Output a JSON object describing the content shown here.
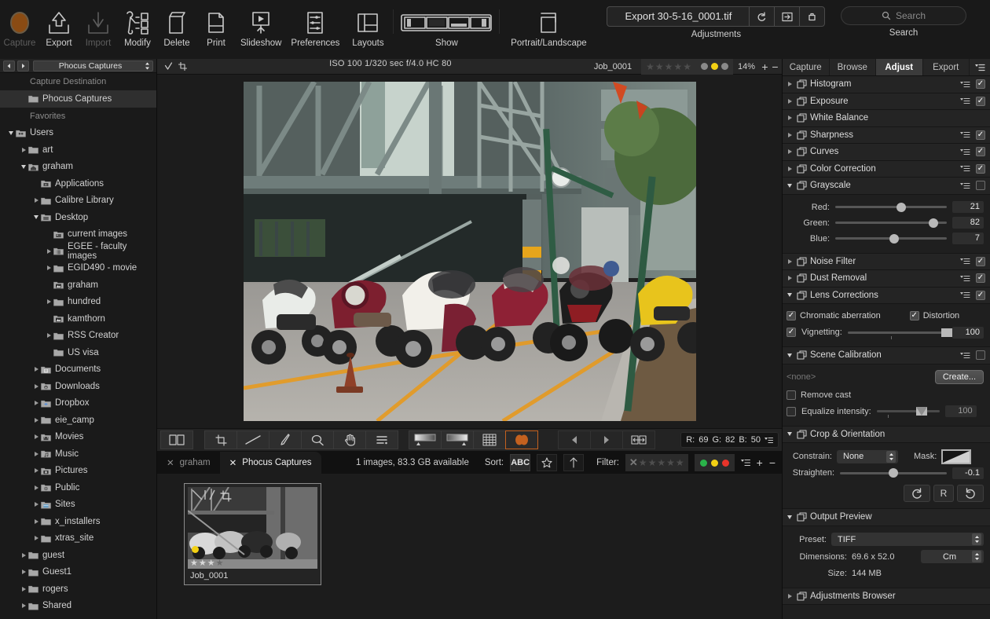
{
  "toolbar": {
    "items": [
      {
        "label": "Capture",
        "icon": "capture-icon",
        "dim": true
      },
      {
        "label": "Export",
        "icon": "export-icon",
        "dim": false
      },
      {
        "label": "Import",
        "icon": "import-icon",
        "dim": true
      },
      {
        "label": "Modify",
        "icon": "modify-icon",
        "dim": false
      },
      {
        "label": "Delete",
        "icon": "delete-icon",
        "dim": false
      },
      {
        "label": "Print",
        "icon": "print-icon",
        "dim": false
      },
      {
        "label": "Slideshow",
        "icon": "slideshow-icon",
        "dim": false
      },
      {
        "label": "Preferences",
        "icon": "preferences-icon",
        "dim": false
      },
      {
        "label": "Layouts",
        "icon": "layouts-icon",
        "dim": false
      },
      {
        "label": "Show",
        "icon": "show-icon",
        "dim": false
      },
      {
        "label": "Portrait/Landscape",
        "icon": "portrait-landscape-icon",
        "dim": false
      }
    ],
    "adjustments": {
      "label": "Adjustments",
      "value": "Export 30-5-16_0001.tif",
      "reset_icon": "reset-arrow-icon",
      "apply_icon": "apply-to-icon",
      "paste_icon": "paste-adjustments-icon"
    },
    "search": {
      "label": "Search",
      "placeholder": "Search",
      "icon": "search-icon"
    }
  },
  "sidebar": {
    "popup_value": "Phocus Captures",
    "sections": [
      {
        "title": "Capture Destination",
        "rows": [
          {
            "label": "Phocus Captures",
            "indent": 1,
            "twisty": "none",
            "icon": "folder-icon",
            "selected": true
          }
        ]
      },
      {
        "title": "Favorites",
        "rows": [
          {
            "label": "Users",
            "indent": 0,
            "twisty": "down",
            "icon": "users-folder-icon",
            "selected": false
          },
          {
            "label": "art",
            "indent": 1,
            "twisty": "right",
            "icon": "folder-icon",
            "selected": false
          },
          {
            "label": "graham",
            "indent": 1,
            "twisty": "down",
            "icon": "home-folder-icon",
            "selected": false
          },
          {
            "label": "Applications",
            "indent": 2,
            "twisty": "none",
            "icon": "applications-folder-icon",
            "selected": false
          },
          {
            "label": "Calibre Library",
            "indent": 2,
            "twisty": "right",
            "icon": "folder-icon",
            "selected": false
          },
          {
            "label": "Desktop",
            "indent": 2,
            "twisty": "down",
            "icon": "desktop-folder-icon",
            "selected": false
          },
          {
            "label": "current images",
            "indent": 3,
            "twisty": "none",
            "icon": "image-folder-icon",
            "selected": false
          },
          {
            "label": "EGEE - faculty images",
            "indent": 3,
            "twisty": "right",
            "icon": "book-folder-icon",
            "selected": false
          },
          {
            "label": "EGID490 - movie",
            "indent": 3,
            "twisty": "right",
            "icon": "folder-icon",
            "selected": false
          },
          {
            "label": "graham",
            "indent": 3,
            "twisty": "none",
            "icon": "photo-folder-icon",
            "selected": false
          },
          {
            "label": "hundred",
            "indent": 3,
            "twisty": "right",
            "icon": "folder-icon",
            "selected": false
          },
          {
            "label": "kamthorn",
            "indent": 3,
            "twisty": "none",
            "icon": "photo-folder-icon",
            "selected": false
          },
          {
            "label": "RSS Creator",
            "indent": 3,
            "twisty": "right",
            "icon": "folder-icon",
            "selected": false
          },
          {
            "label": "US visa",
            "indent": 3,
            "twisty": "none",
            "icon": "folder-icon",
            "selected": false
          },
          {
            "label": "Documents",
            "indent": 2,
            "twisty": "right",
            "icon": "documents-folder-icon",
            "selected": false
          },
          {
            "label": "Downloads",
            "indent": 2,
            "twisty": "right",
            "icon": "downloads-folder-icon",
            "selected": false
          },
          {
            "label": "Dropbox",
            "indent": 2,
            "twisty": "right",
            "icon": "dropbox-folder-icon",
            "selected": false
          },
          {
            "label": "eie_camp",
            "indent": 2,
            "twisty": "right",
            "icon": "folder-icon",
            "selected": false
          },
          {
            "label": "Movies",
            "indent": 2,
            "twisty": "right",
            "icon": "movies-folder-icon",
            "selected": false
          },
          {
            "label": "Music",
            "indent": 2,
            "twisty": "right",
            "icon": "music-folder-icon",
            "selected": false
          },
          {
            "label": "Pictures",
            "indent": 2,
            "twisty": "right",
            "icon": "pictures-folder-icon",
            "selected": false
          },
          {
            "label": "Public",
            "indent": 2,
            "twisty": "right",
            "icon": "public-folder-icon",
            "selected": false
          },
          {
            "label": "Sites",
            "indent": 2,
            "twisty": "right",
            "icon": "sites-folder-icon",
            "selected": false
          },
          {
            "label": "x_installers",
            "indent": 2,
            "twisty": "right",
            "icon": "folder-icon",
            "selected": false
          },
          {
            "label": "xtras_site",
            "indent": 2,
            "twisty": "right",
            "icon": "folder-icon",
            "selected": false
          },
          {
            "label": "guest",
            "indent": 1,
            "twisty": "right",
            "icon": "folder-icon",
            "selected": false
          },
          {
            "label": "Guest1",
            "indent": 1,
            "twisty": "right",
            "icon": "folder-icon",
            "selected": false
          },
          {
            "label": "rogers",
            "indent": 1,
            "twisty": "right",
            "icon": "folder-icon",
            "selected": false
          },
          {
            "label": "Shared",
            "indent": 1,
            "twisty": "right",
            "icon": "folder-icon",
            "selected": false
          }
        ]
      }
    ]
  },
  "infobar": {
    "exif": "ISO 100  1/320 sec  f/4.0  HC 80",
    "job": "Job_0001",
    "stars": 0,
    "zoom": "14%",
    "plus": "+",
    "minus": "−",
    "dot_colors": [
      "#8a8a8a",
      "#f2d014",
      "#8a8a8a"
    ]
  },
  "tools": {
    "buttons": [
      {
        "name": "compare-icon"
      },
      {
        "name": "crop-icon"
      },
      {
        "name": "straighten-icon"
      },
      {
        "name": "eyedropper-icon"
      },
      {
        "name": "zoom-tool-icon"
      },
      {
        "name": "hand-tool-icon"
      },
      {
        "name": "levels-icon"
      },
      {
        "name": "gradient-down-icon"
      },
      {
        "name": "gradient-up-icon"
      },
      {
        "name": "grid-icon"
      },
      {
        "name": "mask-orange-icon"
      },
      {
        "name": "prev-icon"
      },
      {
        "name": "next-icon"
      },
      {
        "name": "flip-icon"
      }
    ],
    "rgb": {
      "r_label": "R:",
      "r": "69",
      "g_label": "G:",
      "g": "82",
      "b_label": "B:",
      "b": "50"
    }
  },
  "browser": {
    "tabs": [
      {
        "label": "graham",
        "active": false
      },
      {
        "label": "Phocus Captures",
        "active": true
      }
    ],
    "status": "1 images, 83.3 GB available",
    "sort_label": "Sort:",
    "sort_value": "ABC",
    "filter_label": "Filter:",
    "filter_colors": [
      "#2ab34a",
      "#f2d014",
      "#e8342a"
    ],
    "thumbnail": {
      "name": "Job_0001",
      "stars": 3,
      "dot_color": "#f2d014"
    }
  },
  "right": {
    "tabs": [
      {
        "label": "Capture",
        "active": false
      },
      {
        "label": "Browse",
        "active": false
      },
      {
        "label": "Adjust",
        "active": true
      },
      {
        "label": "Export",
        "active": false
      }
    ],
    "tools": [
      {
        "name": "Histogram",
        "open": false,
        "checked": true,
        "menu": true
      },
      {
        "name": "Exposure",
        "open": false,
        "checked": true,
        "menu": true
      },
      {
        "name": "White Balance",
        "open": false,
        "checked": false,
        "menu": false
      },
      {
        "name": "Sharpness",
        "open": false,
        "checked": true,
        "menu": true
      },
      {
        "name": "Curves",
        "open": false,
        "checked": true,
        "menu": true
      },
      {
        "name": "Color Correction",
        "open": false,
        "checked": true,
        "menu": true
      },
      {
        "name": "Grayscale",
        "open": true,
        "checked": false,
        "menu": true
      },
      {
        "name": "Noise Filter",
        "open": false,
        "checked": true,
        "menu": true
      },
      {
        "name": "Dust Removal",
        "open": false,
        "checked": true,
        "menu": true
      },
      {
        "name": "Lens Corrections",
        "open": true,
        "checked": true,
        "menu": true
      },
      {
        "name": "Scene Calibration",
        "open": true,
        "checked": false,
        "menu": true
      },
      {
        "name": "Crop & Orientation",
        "open": true,
        "checked": false,
        "menu": false
      },
      {
        "name": "Output Preview",
        "open": true,
        "checked": false,
        "menu": false
      },
      {
        "name": "Adjustments Browser",
        "open": false,
        "checked": false,
        "menu": false
      }
    ],
    "grayscale": {
      "red_label": "Red:",
      "red": "21",
      "red_pct": 21,
      "green_label": "Green:",
      "green": "82",
      "green_pct": 82,
      "blue_label": "Blue:",
      "blue": "7",
      "blue_pct": 7
    },
    "lens": {
      "chromatic_label": "Chromatic aberration",
      "chromatic_on": true,
      "distortion_label": "Distortion",
      "distortion_on": true,
      "vignetting_label": "Vignetting:",
      "vignetting_on": true,
      "vignetting": "100",
      "vignetting_pct": 100
    },
    "scene": {
      "none_text": "<none>",
      "create_label": "Create...",
      "remove_cast_label": "Remove cast",
      "remove_cast_on": false,
      "equalize_label": "Equalize intensity:",
      "equalize_on": false,
      "equalize": "100",
      "equalize_pct": 72
    },
    "crop": {
      "constrain_label": "Constrain:",
      "constrain_value": "None",
      "mask_label": "Mask:",
      "straighten_label": "Straighten:",
      "straighten": "-0.1",
      "straighten_pct": 50,
      "rotate_cw_icon": "rotate-cw-icon",
      "reset_label": "R",
      "rotate_ccw_icon": "rotate-ccw-icon"
    },
    "output": {
      "preset_label": "Preset:",
      "preset_value": "TIFF",
      "dimensions_label": "Dimensions:",
      "dimensions_value": "69.6 x 52.0",
      "unit_value": "Cm",
      "size_label": "Size:",
      "size_value": "144 MB"
    }
  }
}
